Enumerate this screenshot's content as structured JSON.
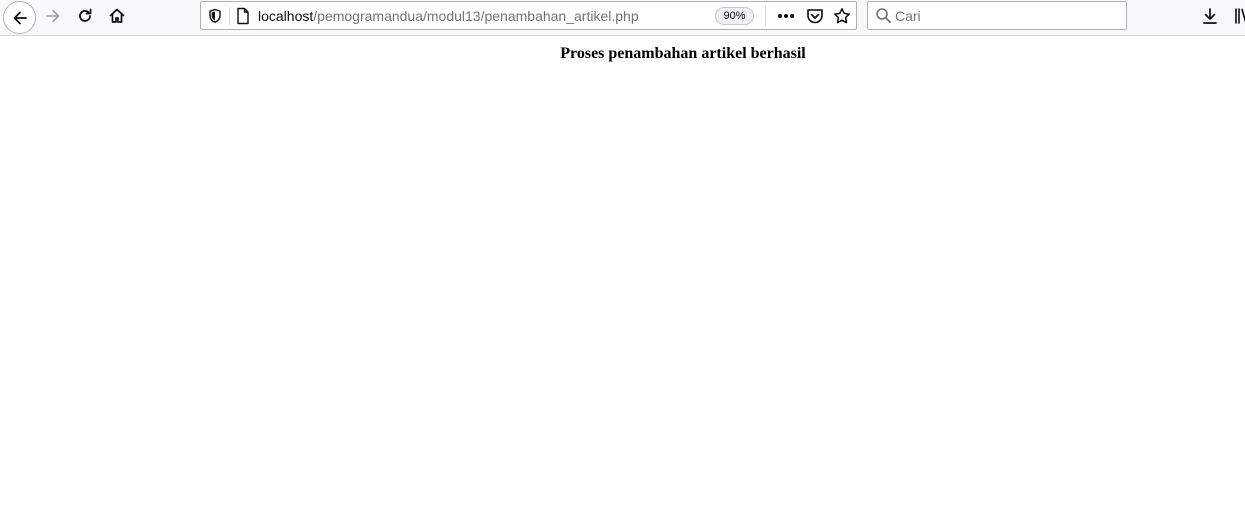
{
  "browser": {
    "url_host": "localhost",
    "url_path": "/pemogramandua/modul13/penambahan_artikel.php",
    "zoom": "90%",
    "search_placeholder": "Cari"
  },
  "page": {
    "message": "Proses penambahan artikel berhasil"
  },
  "colors": {
    "toolbar_bg": "#f9f9fb",
    "icon": "#0c0c0d",
    "disabled_icon": "#a0a0a0"
  }
}
